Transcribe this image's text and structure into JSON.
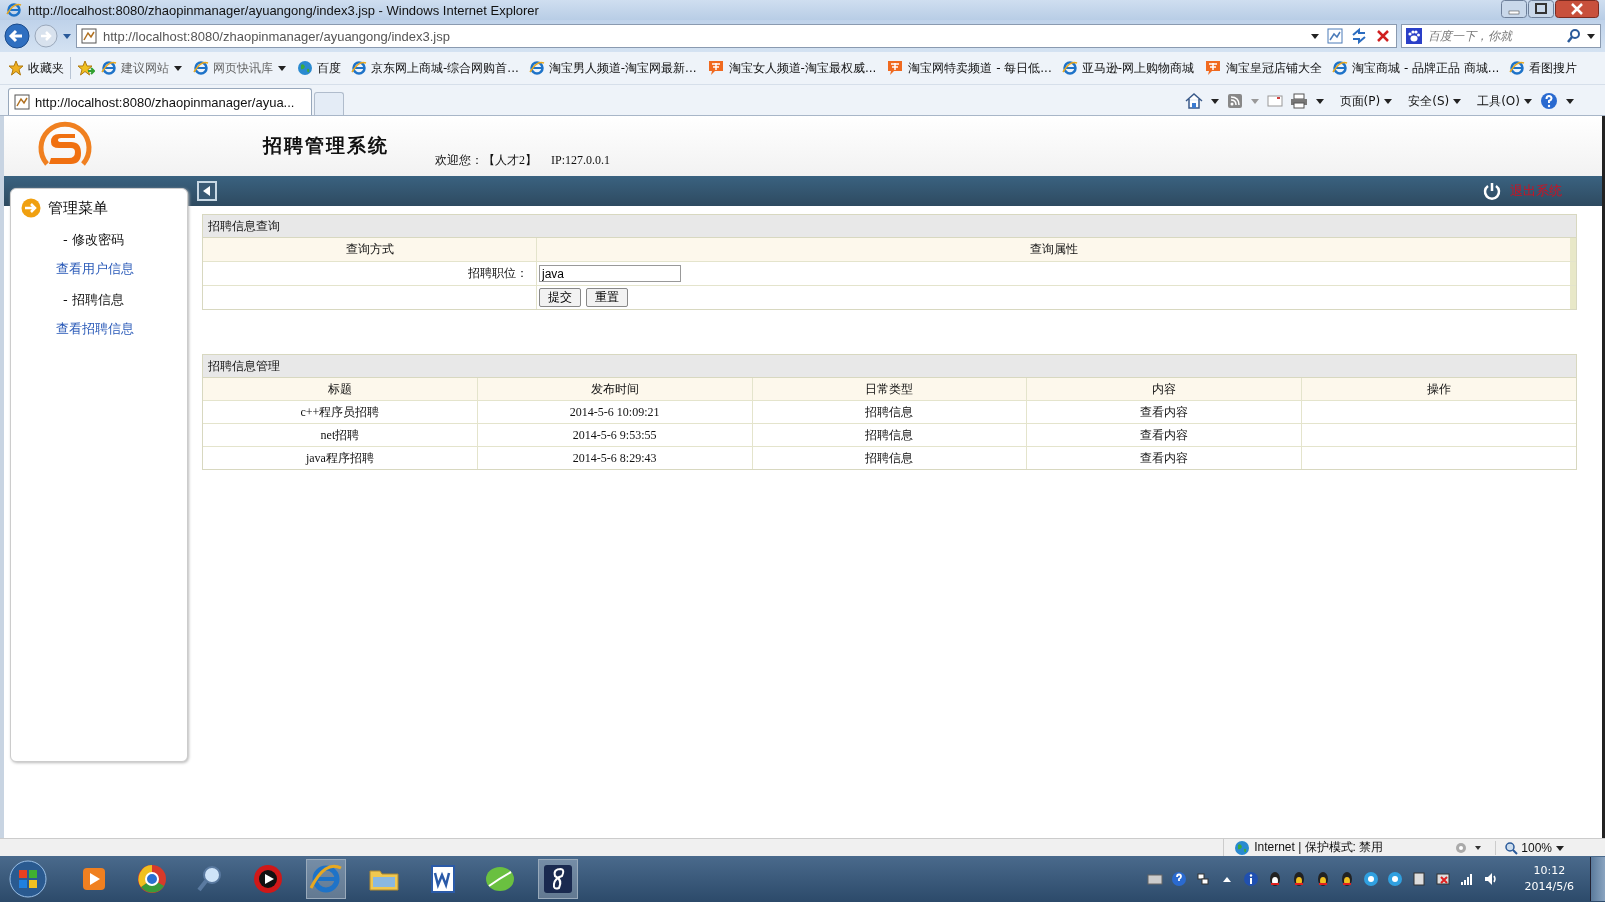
{
  "browser": {
    "title": "http://localhost:8080/zhaopinmanager/ayuangong/index3.jsp - Windows Internet Explorer",
    "address": "http://localhost:8080/zhaopinmanager/ayuangong/index3.jsp",
    "search_placeholder": "百度一下，你就",
    "favorites_label": "收藏夹",
    "favorites": [
      {
        "label": "建议网站",
        "kind": "ie",
        "dropdown": true
      },
      {
        "label": "网页快讯库",
        "kind": "ie",
        "dropdown": true
      },
      {
        "label": "百度",
        "kind": "globe",
        "dropdown": false
      },
      {
        "label": "京东网上商城-综合网购首...",
        "kind": "ie",
        "dropdown": false
      },
      {
        "label": "淘宝男人频道-淘宝网最新...",
        "kind": "ie",
        "dropdown": false
      },
      {
        "label": "淘宝女人频道-淘宝最权威...",
        "kind": "tao",
        "dropdown": false
      },
      {
        "label": "淘宝网特卖频道 - 每日低...",
        "kind": "tao",
        "dropdown": false
      },
      {
        "label": "亚马逊-网上购物商城",
        "kind": "ie",
        "dropdown": false
      },
      {
        "label": "淘宝皇冠店铺大全",
        "kind": "tao",
        "dropdown": false
      },
      {
        "label": "淘宝商城 - 品牌正品 商城...",
        "kind": "ie",
        "dropdown": false
      },
      {
        "label": "看图搜片",
        "kind": "ie",
        "dropdown": false
      }
    ],
    "tab_title": "http://localhost:8080/zhaopinmanager/ayua...",
    "menus": [
      "页面(P)",
      "安全(S)",
      "工具(O)"
    ]
  },
  "page": {
    "header": {
      "title": "招聘管理系统",
      "welcome": "欢迎您：【人才2】",
      "ip": "IP:127.0.0.1"
    },
    "logout": "退出系统",
    "sidebar": {
      "title": "管理菜单",
      "items": [
        {
          "label": "- 修改密码",
          "kind": "section"
        },
        {
          "label": "查看用户信息",
          "kind": "link"
        },
        {
          "label": "- 招聘信息",
          "kind": "section"
        },
        {
          "label": "查看招聘信息",
          "kind": "link"
        }
      ]
    },
    "query": {
      "title": "招聘信息查询",
      "columns": [
        "查询方式",
        "查询属性"
      ],
      "field_label": "招聘职位：",
      "field_value": "java",
      "buttons": [
        "提交",
        "重置"
      ]
    },
    "manage": {
      "title": "招聘信息管理",
      "columns": [
        "标题",
        "发布时间",
        "日常类型",
        "内容",
        "操作"
      ],
      "rows": [
        [
          "c++程序员招聘",
          "2014-5-6 10:09:21",
          "招聘信息",
          "查看内容"
        ],
        [
          "net招聘",
          "2014-5-6 9:53:55",
          "招聘信息",
          "查看内容"
        ],
        [
          "java程序招聘",
          "2014-5-6 8:29:43",
          "招聘信息",
          "查看内容"
        ]
      ]
    }
  },
  "status_bar": {
    "zone": "Internet | 保护模式: 禁用",
    "zoom": "100%"
  },
  "taskbar": {
    "time": "10:12",
    "date": "2014/5/6"
  }
}
